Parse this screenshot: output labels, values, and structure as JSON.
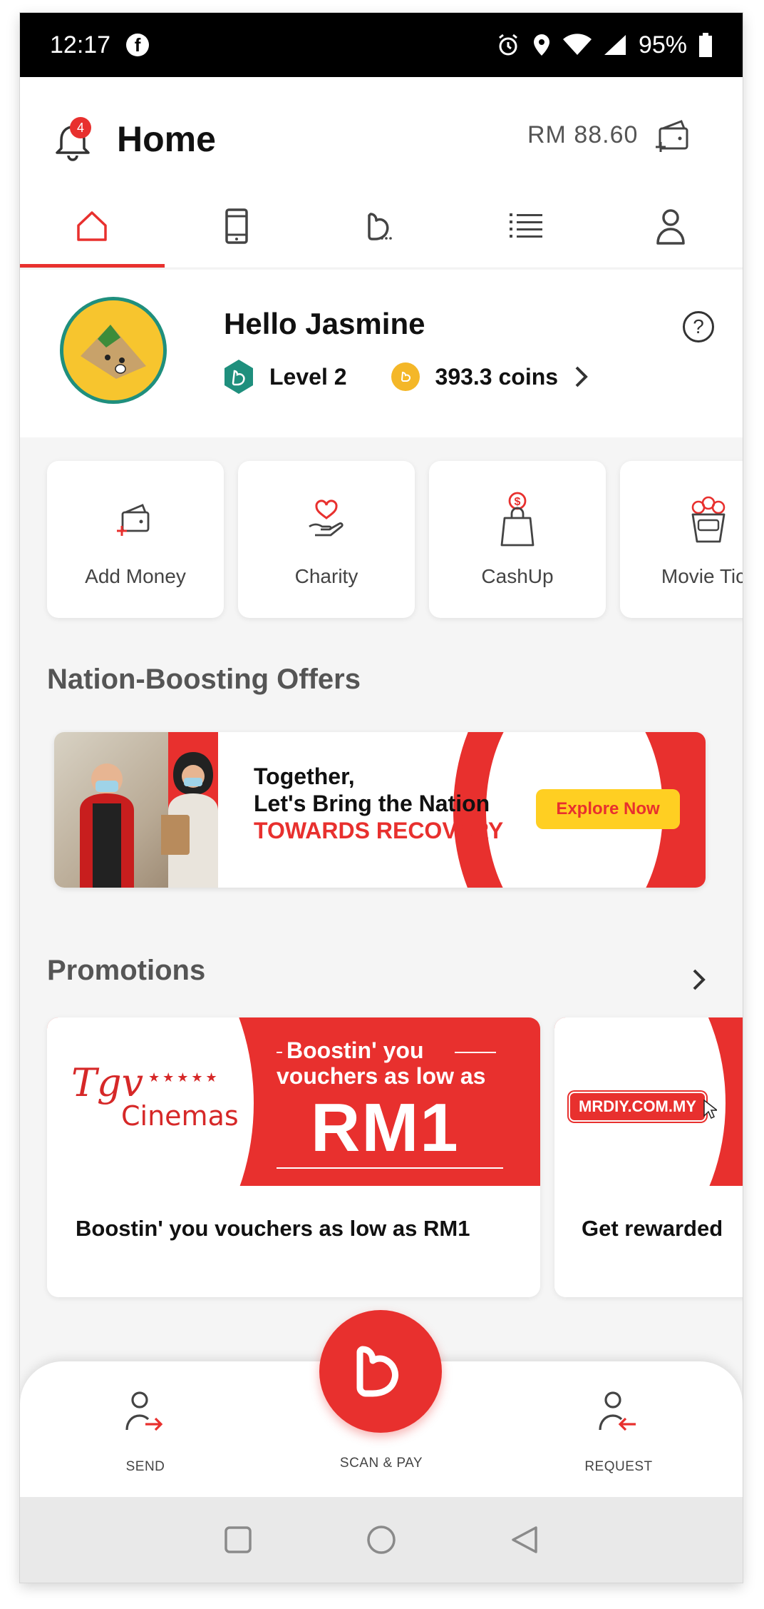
{
  "status_bar": {
    "time": "12:17",
    "battery": "95%"
  },
  "header": {
    "title": "Home",
    "balance": "RM 88.60",
    "notification_count": "4"
  },
  "tabs": [
    {
      "icon": "home-icon",
      "active": true
    },
    {
      "icon": "phone-icon",
      "active": false
    },
    {
      "icon": "boost-deals-icon",
      "active": false
    },
    {
      "icon": "list-icon",
      "active": false
    },
    {
      "icon": "profile-icon",
      "active": false
    }
  ],
  "profile": {
    "greeting": "Hello Jasmine",
    "level": "Level 2",
    "coins": "393.3 coins"
  },
  "quick_actions": [
    {
      "label": "Add Money",
      "icon": "add-money-icon"
    },
    {
      "label": "Charity",
      "icon": "charity-icon"
    },
    {
      "label": "CashUp",
      "icon": "cashup-icon"
    },
    {
      "label": "Movie Tick",
      "icon": "popcorn-icon"
    }
  ],
  "offers": {
    "title": "Nation-Boosting Offers",
    "banner": {
      "line1": "Together,",
      "line2": "Let's Bring the Nation",
      "line3": "TOWARDS RECOVERY",
      "cta": "Explore Now"
    }
  },
  "promotions": {
    "title": "Promotions",
    "items": [
      {
        "logo_text": "Cinemas",
        "headline_line1": "Boostin' you",
        "headline_line2": "vouchers as low as",
        "headline_price": "RM1",
        "caption": "Boostin' you vouchers as low as RM1"
      },
      {
        "logo_text": "MRDIY.COM.MY",
        "caption": "Get rewarded"
      }
    ]
  },
  "bottom_nav": {
    "send": "SEND",
    "scan_pay": "SCAN & PAY",
    "request": "REQUEST"
  },
  "colors": {
    "brand_red": "#e8302e",
    "cta_yellow": "#ffcf22",
    "coin_gold": "#f4b728",
    "level_teal": "#1f8f7d"
  }
}
